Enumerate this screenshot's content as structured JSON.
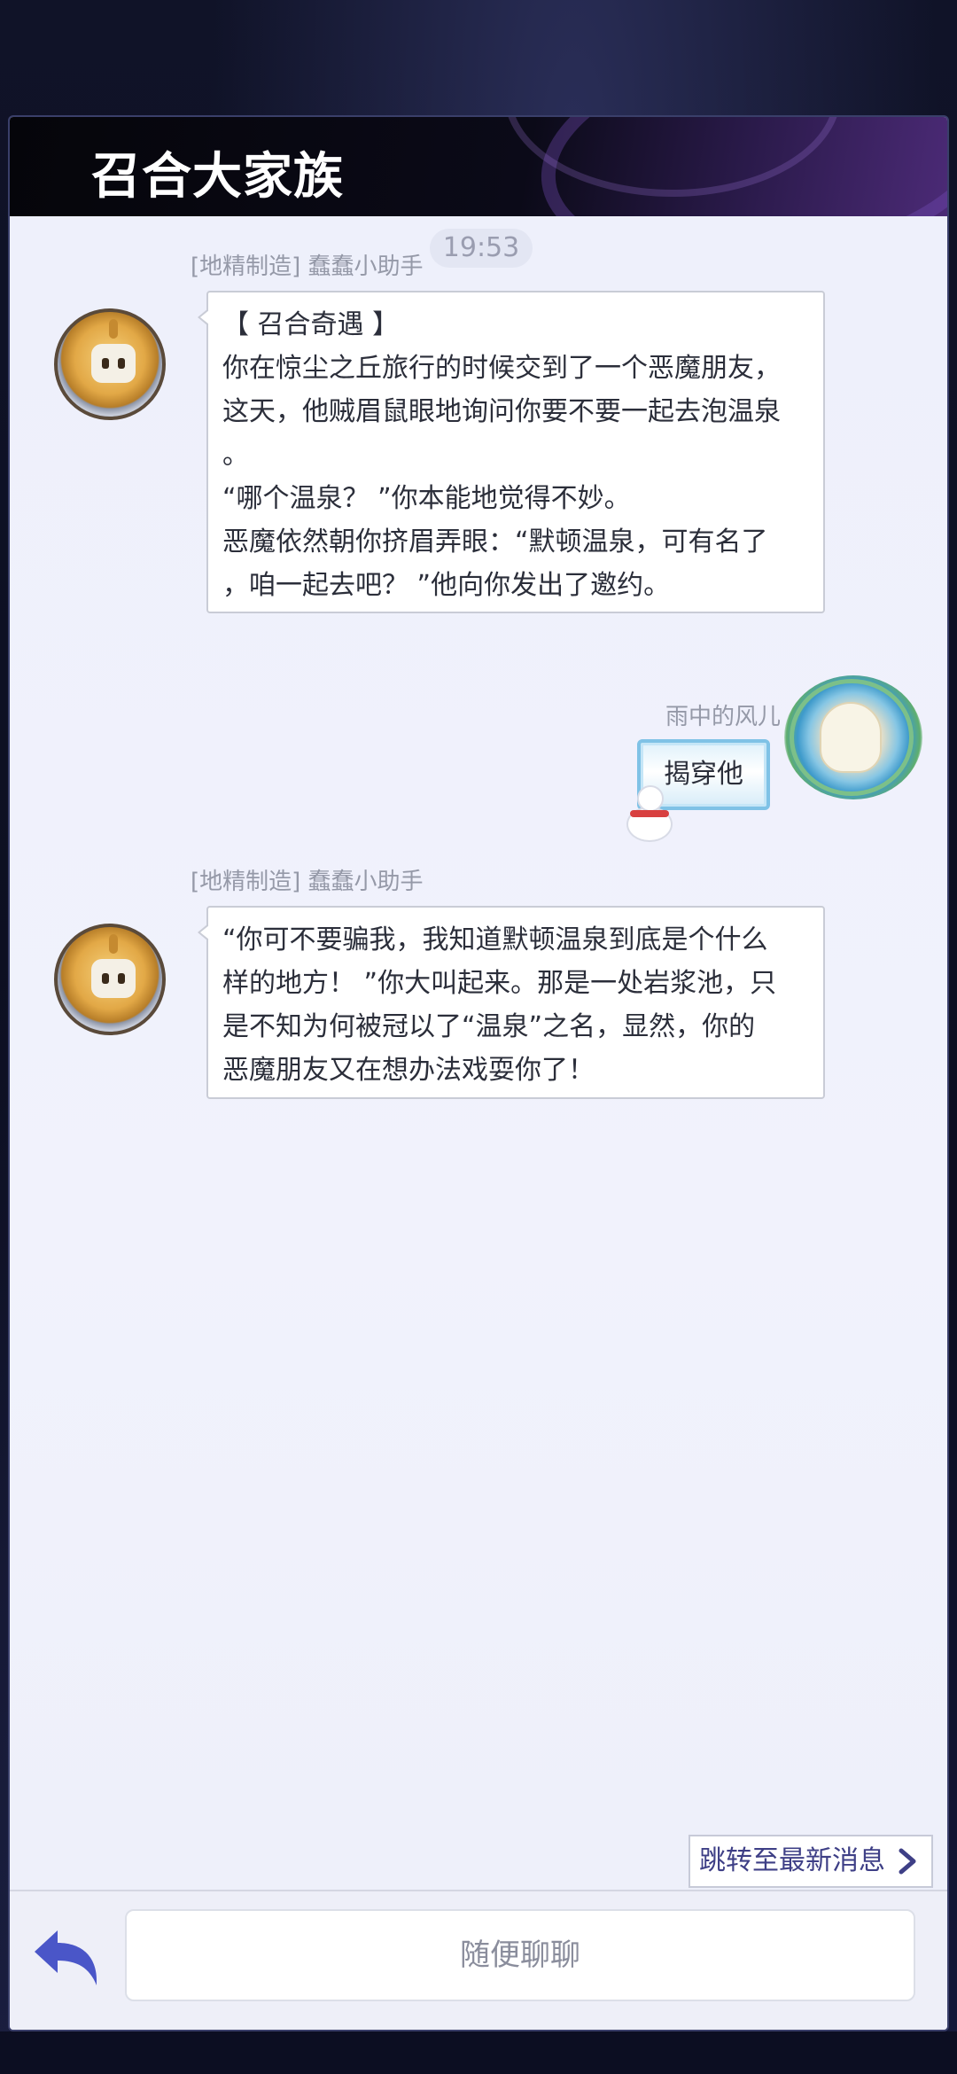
{
  "header": {
    "title": "召合大家族"
  },
  "chat": {
    "time": "19:53",
    "messages": [
      {
        "sender": "[地精制造] 蠢蠢小助手",
        "side": "left",
        "avatar_icon": "robot-avatar-icon",
        "lines": [
          "【 召合奇遇 】",
          "你在惊尘之丘旅行的时候交到了一个恶魔朋友，",
          "这天，他贼眉鼠眼地询问你要不要一起去泡温泉",
          "。",
          "“哪个温泉？ ”你本能地觉得不妙。",
          "恶魔依然朝你挤眉弄眼：“默顿温泉，可有名了",
          "，咱一起去吧？ ”他向你发出了邀约。"
        ]
      },
      {
        "sender": "雨中的风儿",
        "side": "right",
        "avatar_icon": "player-avatar-icon",
        "text": "揭穿他"
      },
      {
        "sender": "[地精制造] 蠢蠢小助手",
        "side": "left",
        "avatar_icon": "robot-avatar-icon",
        "lines": [
          "“你可不要骗我，我知道默顿温泉到底是个什么",
          "样的地方！ ”你大叫起来。那是一处岩浆池，只",
          "是不知为何被冠以了“温泉”之名，显然，你的",
          "恶魔朋友又在想办法戏耍你了！"
        ]
      }
    ],
    "jump_label": "跳转至最新消息"
  },
  "input": {
    "placeholder": "随便聊聊",
    "value": ""
  },
  "colors": {
    "accent": "#3e3f86",
    "reply_icon": "#4a56c8",
    "chat_bg": "#f1f2fb",
    "bubble_border": "#c9ccd6"
  }
}
